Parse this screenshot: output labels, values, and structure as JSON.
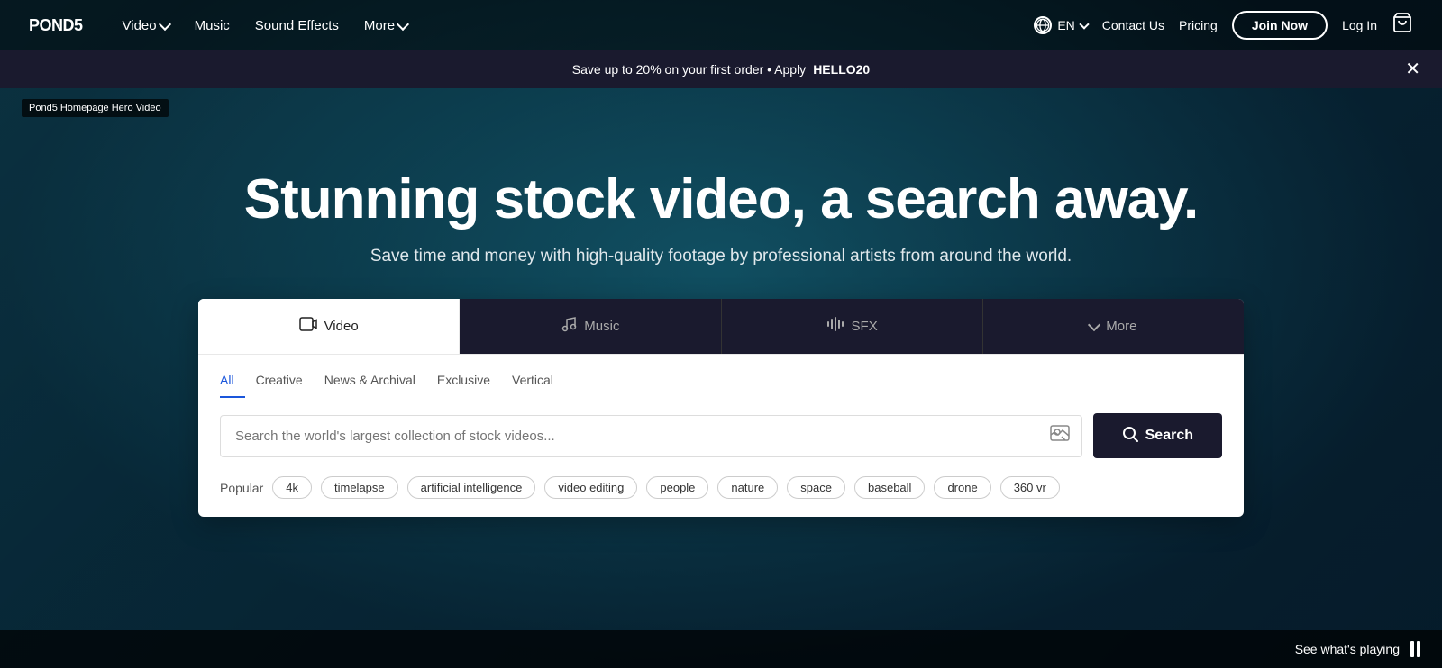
{
  "logo": {
    "text": "POND5"
  },
  "navbar": {
    "video_label": "Video",
    "music_label": "Music",
    "sound_effects_label": "Sound Effects",
    "more_label": "More",
    "lang": "EN",
    "contact_label": "Contact Us",
    "pricing_label": "Pricing",
    "join_label": "Join Now",
    "login_label": "Log In"
  },
  "promo_banner": {
    "text": "Save up to 20% on your first order • Apply ",
    "code": "HELLO20"
  },
  "video_tooltip": "Pond5 Homepage Hero Video",
  "hero": {
    "title": "Stunning stock video, a search away.",
    "subtitle": "Save time and money with high-quality footage by professional artists from around the world."
  },
  "search_tabs": [
    {
      "label": "Video",
      "icon": "📷",
      "active": true
    },
    {
      "label": "Music",
      "icon": "🎵",
      "active": false
    },
    {
      "label": "SFX",
      "icon": "🔊",
      "active": false
    },
    {
      "label": "More",
      "icon": "▾",
      "active": false
    }
  ],
  "search_subtabs": [
    {
      "label": "All",
      "active": true
    },
    {
      "label": "Creative",
      "active": false
    },
    {
      "label": "News & Archival",
      "active": false
    },
    {
      "label": "Exclusive",
      "active": false
    },
    {
      "label": "Vertical",
      "active": false
    }
  ],
  "search_input": {
    "placeholder": "Search the world's largest collection of stock videos...",
    "value": ""
  },
  "search_button": "Search",
  "popular": {
    "label": "Popular",
    "tags": [
      "4k",
      "timelapse",
      "artificial intelligence",
      "video editing",
      "people",
      "nature",
      "space",
      "baseball",
      "drone",
      "360 vr"
    ]
  },
  "bottom_bar": {
    "see_playing": "See what's playing"
  }
}
